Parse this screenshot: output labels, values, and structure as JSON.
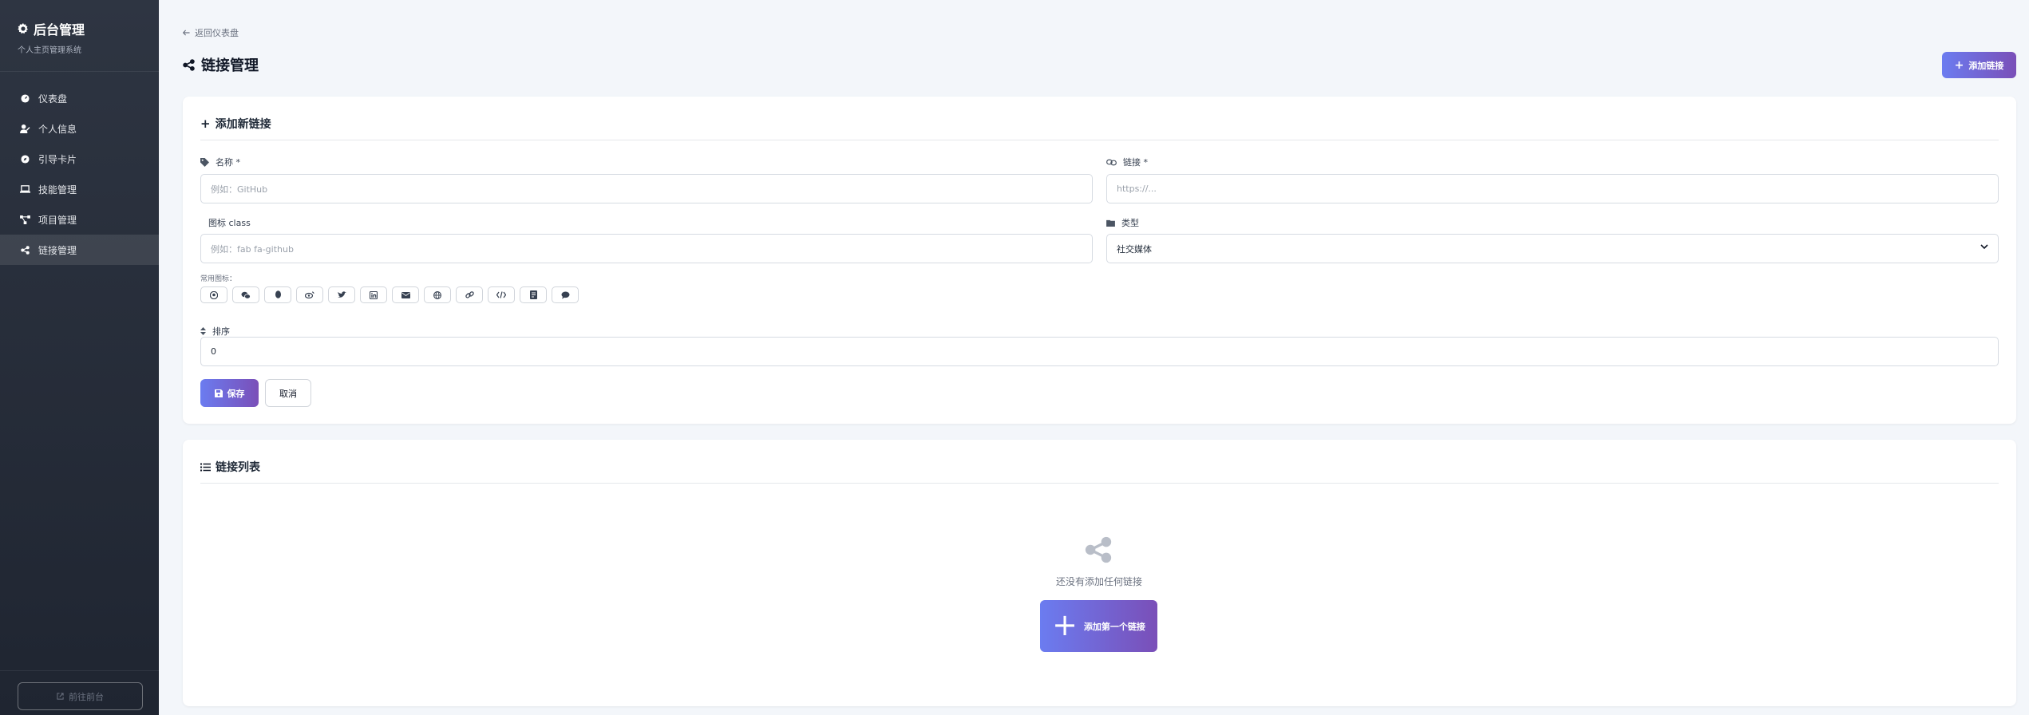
{
  "sidebar": {
    "brand_title": "后台管理",
    "brand_subtitle": "个人主页管理系统",
    "items": [
      {
        "label": "仪表盘",
        "icon": "dashboard-icon"
      },
      {
        "label": "个人信息",
        "icon": "user-edit-icon"
      },
      {
        "label": "引导卡片",
        "icon": "compass-icon"
      },
      {
        "label": "技能管理",
        "icon": "laptop-icon"
      },
      {
        "label": "项目管理",
        "icon": "project-diagram-icon"
      },
      {
        "label": "链接管理",
        "icon": "share-icon",
        "active": true
      }
    ],
    "bottom_button": "前往前台"
  },
  "header": {
    "back_label": "返回仪表盘",
    "title": "链接管理",
    "add_button": "添加链接"
  },
  "form": {
    "title": "添加新链接",
    "name_label": "名称 *",
    "name_placeholder": "例如：GitHub",
    "url_label": "链接 *",
    "url_placeholder": "https://...",
    "icon_label": "图标 class",
    "icon_placeholder": "例如：fab fa-github",
    "type_label": "类型",
    "type_value": "社交媒体",
    "common_icons_label": "常用图标：",
    "common_icons": [
      "github-icon",
      "wechat-icon",
      "qq-icon",
      "weibo-icon",
      "twitter-icon",
      "linkedin-icon",
      "email-icon",
      "globe-icon",
      "link-icon",
      "code-icon",
      "blog-icon",
      "comment-icon"
    ],
    "order_label": "排序",
    "order_value": "0",
    "save_label": "保存",
    "cancel_label": "取消"
  },
  "list": {
    "title": "链接列表",
    "empty_text": "还没有添加任何链接",
    "empty_button": "添加第一个链接"
  },
  "colors": {
    "accent_start": "#6b7cf0",
    "accent_end": "#7a4fb8",
    "sidebar": "#2a313d"
  }
}
